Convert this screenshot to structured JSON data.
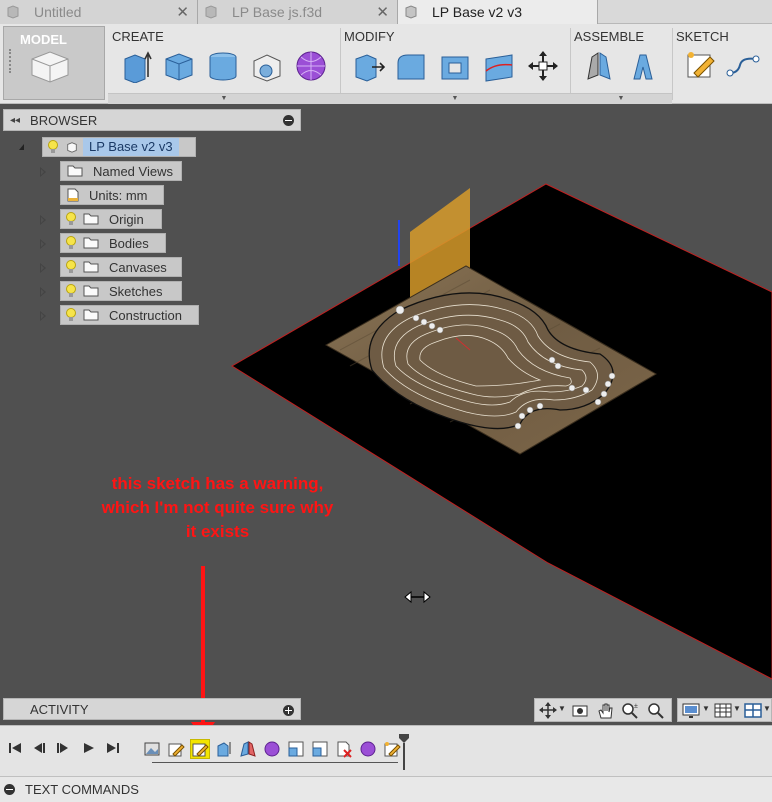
{
  "tabs": [
    {
      "label": "Untitled",
      "active": false
    },
    {
      "label": "LP Base js.f3d",
      "active": false
    },
    {
      "label": "LP Base v2 v3",
      "active": true
    }
  ],
  "tab_close_glyph": "✕",
  "toolbar": {
    "workspace_label": "MODEL",
    "groups": {
      "create": "CREATE",
      "modify": "MODIFY",
      "assemble": "ASSEMBLE",
      "sketch": "SKETCH"
    }
  },
  "browser": {
    "title": "BROWSER",
    "root": "LP Base v2 v3",
    "items": [
      {
        "label": "Named Views"
      },
      {
        "label": "Units: mm"
      },
      {
        "label": "Origin"
      },
      {
        "label": "Bodies"
      },
      {
        "label": "Canvases"
      },
      {
        "label": "Sketches"
      },
      {
        "label": "Construction"
      }
    ]
  },
  "annotation": {
    "text": "this sketch has a warning, which I'm not quite sure why it exists"
  },
  "activity": {
    "title": "ACTIVITY"
  },
  "text_commands": {
    "title": "TEXT COMMANDS"
  },
  "colors": {
    "accent_red": "#ff1414",
    "highlight_yellow": "#f3e500",
    "selection_blue": "#a9c8ea",
    "viewport_bg": "#505050",
    "plane_black": "#000000"
  }
}
